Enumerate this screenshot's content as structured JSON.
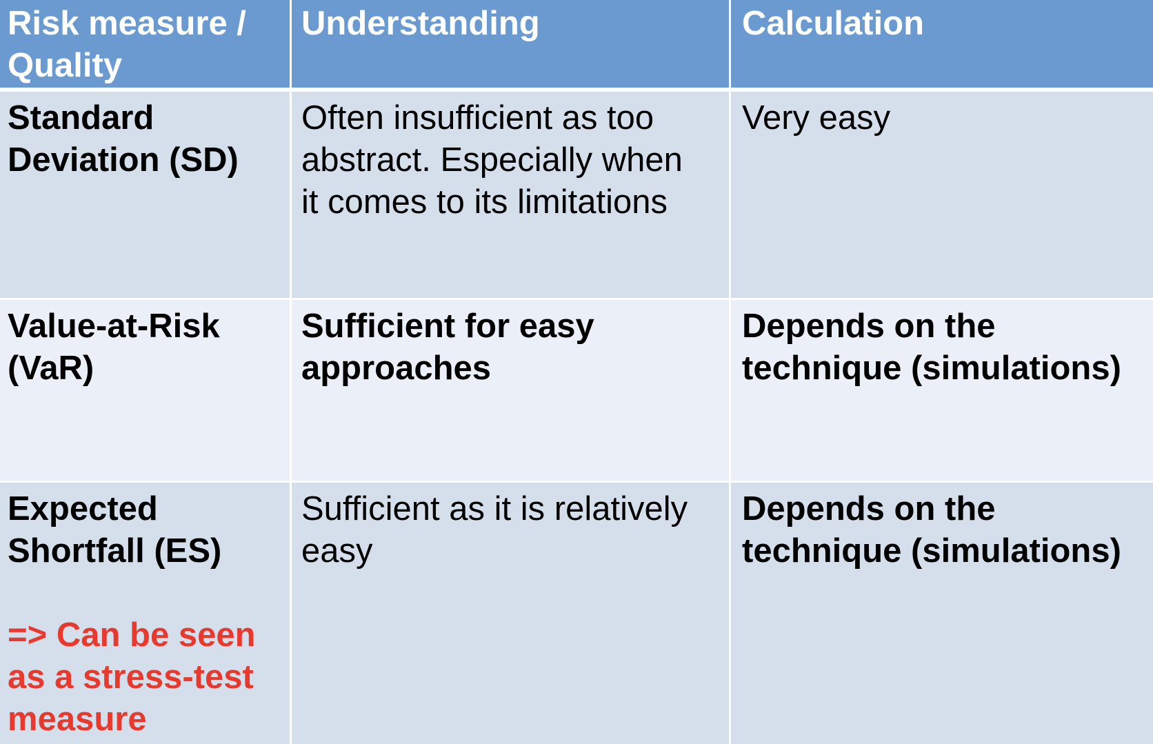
{
  "table": {
    "header": {
      "col1_line1": "Risk measure /",
      "col1_line2": "Quality",
      "col2": "Understanding",
      "col3": "Calculation"
    },
    "rows": [
      {
        "measure_line1": "Standard",
        "measure_line2": "Deviation (SD)",
        "understanding_line1": "Often insufficient as too",
        "understanding_line2": "abstract. Especially when",
        "understanding_line3": "it comes to its limitations",
        "calculation_line1": "Very easy"
      },
      {
        "measure_line1": "Value-at-Risk",
        "measure_line2": "(VaR)",
        "understanding_line1": "Sufficient for easy",
        "understanding_line2": "approaches",
        "calculation_line1": "Depends on the",
        "calculation_line2": "technique (simulations)"
      },
      {
        "measure_line1": "Expected",
        "measure_line2": "Shortfall (ES)",
        "note_line1": "=> Can be seen",
        "note_line2": "as a stress-test",
        "note_line3": "measure",
        "understanding_line1": "Sufficient as it is relatively",
        "understanding_line2": "easy",
        "calculation_line1": "Depends on the",
        "calculation_line2": "technique (simulations)"
      }
    ]
  },
  "colors": {
    "header_bg": "#6a9ad0",
    "row_dark_bg": "#d5dfec",
    "row_light_bg": "#ebeff7",
    "note_red": "#e8392f"
  }
}
